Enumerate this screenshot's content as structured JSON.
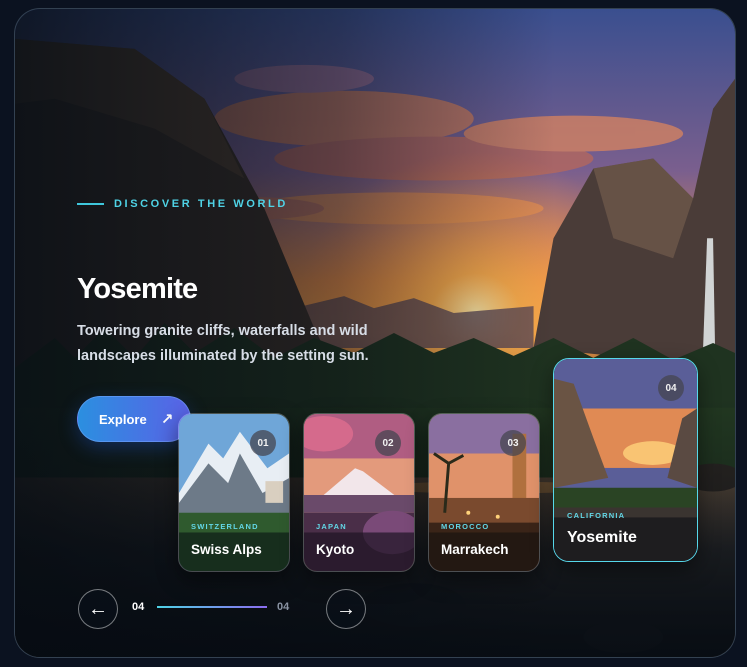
{
  "hero": {
    "eyebrow": "DISCOVER THE WORLD",
    "title": "Yosemite",
    "description": "Towering granite cliffs, waterfalls and wild landscapes illuminated by the setting sun.",
    "cta_label": "Explore",
    "cta_icon": "arrow-up-right-icon"
  },
  "destinations": [
    {
      "index": "01",
      "region": "SWITZERLAND",
      "name": "Swiss Alps"
    },
    {
      "index": "02",
      "region": "JAPAN",
      "name": "Kyoto"
    },
    {
      "index": "03",
      "region": "MOROCCO",
      "name": "Marrakech"
    },
    {
      "index": "04",
      "region": "CALIFORNIA",
      "name": "Yosemite"
    }
  ],
  "pagination": {
    "current": "04",
    "total": "04",
    "progress": 1.0,
    "prev_icon": "arrow-left-icon",
    "next_icon": "arrow-right-icon"
  },
  "colors": {
    "accent": "#4fd3e6",
    "button_start": "#2b8fe0",
    "button_end": "#5a62e6"
  }
}
